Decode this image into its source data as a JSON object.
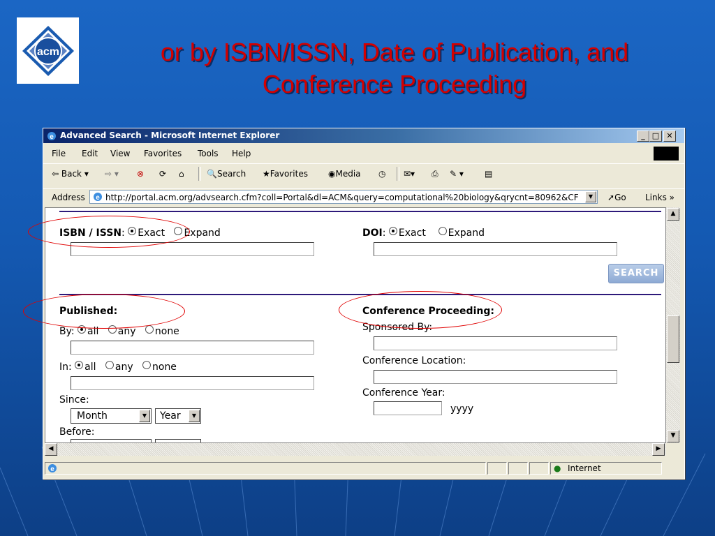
{
  "slide": {
    "title_line1": "or by ISBN/ISSN, Date of Publication, and",
    "title_line2": "Conference Proceeding",
    "logo_text": "acm"
  },
  "window": {
    "title": "Advanced Search - Microsoft Internet Explorer",
    "menus": [
      "File",
      "Edit",
      "View",
      "Favorites",
      "Tools",
      "Help"
    ],
    "toolbar": {
      "back": "Back",
      "search": "Search",
      "favorites": "Favorites",
      "media": "Media"
    },
    "address": {
      "label": "Address",
      "url": "http://portal.acm.org/advsearch.cfm?coll=Portal&dl=ACM&query=computational%20biology&qrycnt=80962&CF",
      "go": "Go",
      "links": "Links"
    },
    "status": {
      "zone": "Internet"
    }
  },
  "form": {
    "isbn": {
      "label": "ISBN / ISSN",
      "opt_exact": "Exact",
      "opt_expand": "Expand",
      "selected": "Exact"
    },
    "doi": {
      "label": "DOI",
      "opt_exact": "Exact",
      "opt_expand": "Expand",
      "selected": "Exact"
    },
    "search_button": "SEARCH",
    "published": {
      "heading": "Published:",
      "by_label": "By:",
      "in_label": "In:",
      "opt_all": "all",
      "opt_any": "any",
      "opt_none": "none",
      "since_label": "Since:",
      "before_label": "Before:",
      "month_value": "Month",
      "year_value": "Year"
    },
    "conference": {
      "heading": "Conference Proceeding:",
      "sponsored_label": "Sponsored By:",
      "location_label": "Conference Location:",
      "year_label": "Conference Year:",
      "year_hint": "yyyy"
    }
  },
  "colors": {
    "title_red": "#d40000",
    "background_blue": "#1459b2",
    "highlight_ellipse": "#e00000"
  }
}
